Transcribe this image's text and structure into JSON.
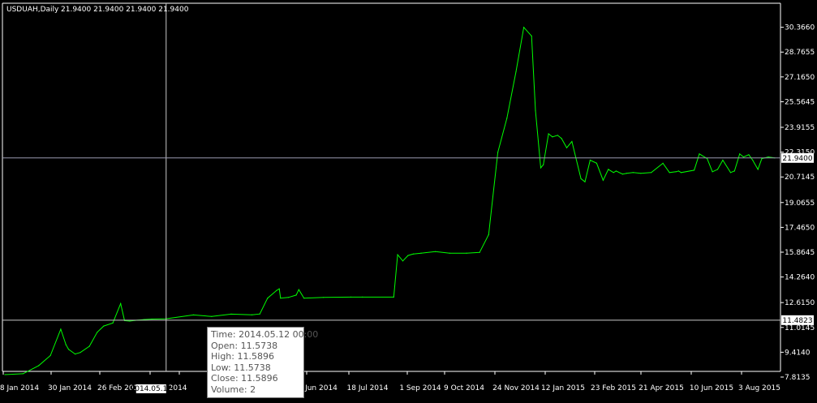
{
  "header": {
    "symbol_label": "USDUAH,Daily",
    "ohlc_label": "21.9400 21.9400 21.9400 21.9400"
  },
  "colors": {
    "background": "#000000",
    "series": "#00ff00",
    "axis": "#ffffff",
    "crosshair": "#c8c8c8",
    "price_tag_bg": "#ffffff",
    "price_tag_fg": "#000000"
  },
  "crosshair": {
    "price_label": "11.4823",
    "time_label": "2014.05.12"
  },
  "current_price_label": "21.9400",
  "tooltip": {
    "time": "Time: 2014.05.12 00:00",
    "open": "Open: 11.5738",
    "high": "High: 11.5896",
    "low": "Low: 11.5738",
    "close": "Close: 11.5896",
    "volume": "Volume: 2"
  },
  "chart_data": {
    "type": "line",
    "title": "USDUAH,Daily",
    "xlabel": "",
    "ylabel": "",
    "ylim": [
      7.8135,
      30.66
    ],
    "xlim": [
      "2014-01-08",
      "2015-08-23"
    ],
    "grid": false,
    "y_ticks": [
      "30.3660",
      "28.7655",
      "27.1650",
      "25.5645",
      "23.9155",
      "22.3150",
      "20.7145",
      "19.0655",
      "17.4650",
      "15.8645",
      "14.2640",
      "12.6150",
      "11.0145",
      "9.4140",
      "7.8135"
    ],
    "x_ticks": [
      "8 Jan 2014",
      "30 Jan 2014",
      "26 Feb 2014",
      "20 Mar 2014",
      "",
      "Jun 2014",
      "18 Jul 2014",
      "1 Sep 2014",
      "9 Oct 2014",
      "24 Nov 2014",
      "12 Jan 2015",
      "23 Feb 2015",
      "21 Apr 2015",
      "10 Jun 2015",
      "3 Aug 2015"
    ],
    "series": [
      {
        "x": [
          "2014-01-08",
          "2014-01-22",
          "2014-02-03",
          "2014-02-12",
          "2014-02-20",
          "2014-02-24",
          "2014-02-26",
          "2014-03-03",
          "2014-03-07",
          "2014-03-14",
          "2014-03-20",
          "2014-03-25",
          "2014-04-01",
          "2014-04-07",
          "2014-04-10",
          "2014-04-14",
          "2014-04-18",
          "2014-04-25",
          "2014-05-01",
          "2014-05-12",
          "2014-06-02",
          "2014-06-16",
          "2014-07-01",
          "2014-07-17",
          "2014-07-23",
          "2014-07-29",
          "2014-08-05",
          "2014-08-07",
          "2014-08-08",
          "2014-08-14",
          "2014-08-20",
          "2014-08-22",
          "2014-08-26",
          "2014-09-10",
          "2014-10-01",
          "2014-10-10",
          "2014-11-03",
          "2014-11-06",
          "2014-11-10",
          "2014-11-14",
          "2014-11-18",
          "2014-11-24",
          "2014-12-05",
          "2014-12-16",
          "2014-12-29",
          "2015-01-08",
          "2015-01-15",
          "2015-01-22",
          "2015-01-29",
          "2015-02-05",
          "2015-02-11",
          "2015-02-17",
          "2015-02-20",
          "2015-02-24",
          "2015-02-26",
          "2015-03-02",
          "2015-03-05",
          "2015-03-09",
          "2015-03-12",
          "2015-03-16",
          "2015-03-20",
          "2015-03-27",
          "2015-03-30",
          "2015-04-03",
          "2015-04-08",
          "2015-04-13",
          "2015-04-17",
          "2015-04-21",
          "2015-04-23",
          "2015-04-28",
          "2015-05-01",
          "2015-05-06",
          "2015-05-12",
          "2015-05-20",
          "2015-05-29",
          "2015-06-03",
          "2015-06-08",
          "2015-06-10",
          "2015-06-12",
          "2015-06-22",
          "2015-06-26",
          "2015-07-02",
          "2015-07-06",
          "2015-07-10",
          "2015-07-14",
          "2015-07-20",
          "2015-07-23",
          "2015-07-27",
          "2015-07-30",
          "2015-08-03",
          "2015-08-06",
          "2015-08-10",
          "2015-08-13",
          "2015-08-18",
          "2015-08-23"
        ],
        "values": [
          7.97,
          8.03,
          8.55,
          9.2,
          10.9,
          9.9,
          9.6,
          9.3,
          9.4,
          9.8,
          10.7,
          11.1,
          11.3,
          12.55,
          11.45,
          11.42,
          11.47,
          11.52,
          11.55,
          11.57,
          11.82,
          11.72,
          11.87,
          11.83,
          11.88,
          12.9,
          13.4,
          13.5,
          12.9,
          12.95,
          13.1,
          13.45,
          12.9,
          12.95,
          12.97,
          12.97,
          12.97,
          15.7,
          15.3,
          15.65,
          15.75,
          15.8,
          15.9,
          15.8,
          15.8,
          15.85,
          17.0,
          22.3,
          24.5,
          27.5,
          30.36,
          29.8,
          25.0,
          21.3,
          21.5,
          23.5,
          23.3,
          23.4,
          23.2,
          22.6,
          23.0,
          20.6,
          20.4,
          21.8,
          21.6,
          20.5,
          21.2,
          21.0,
          21.1,
          20.9,
          20.95,
          21.0,
          20.95,
          21.0,
          21.6,
          21.0,
          21.05,
          21.1,
          21.0,
          21.15,
          22.2,
          21.9,
          21.05,
          21.2,
          21.8,
          21.0,
          21.1,
          22.2,
          22.0,
          22.15,
          21.8,
          21.2,
          21.9,
          22.0,
          21.94
        ]
      }
    ]
  }
}
